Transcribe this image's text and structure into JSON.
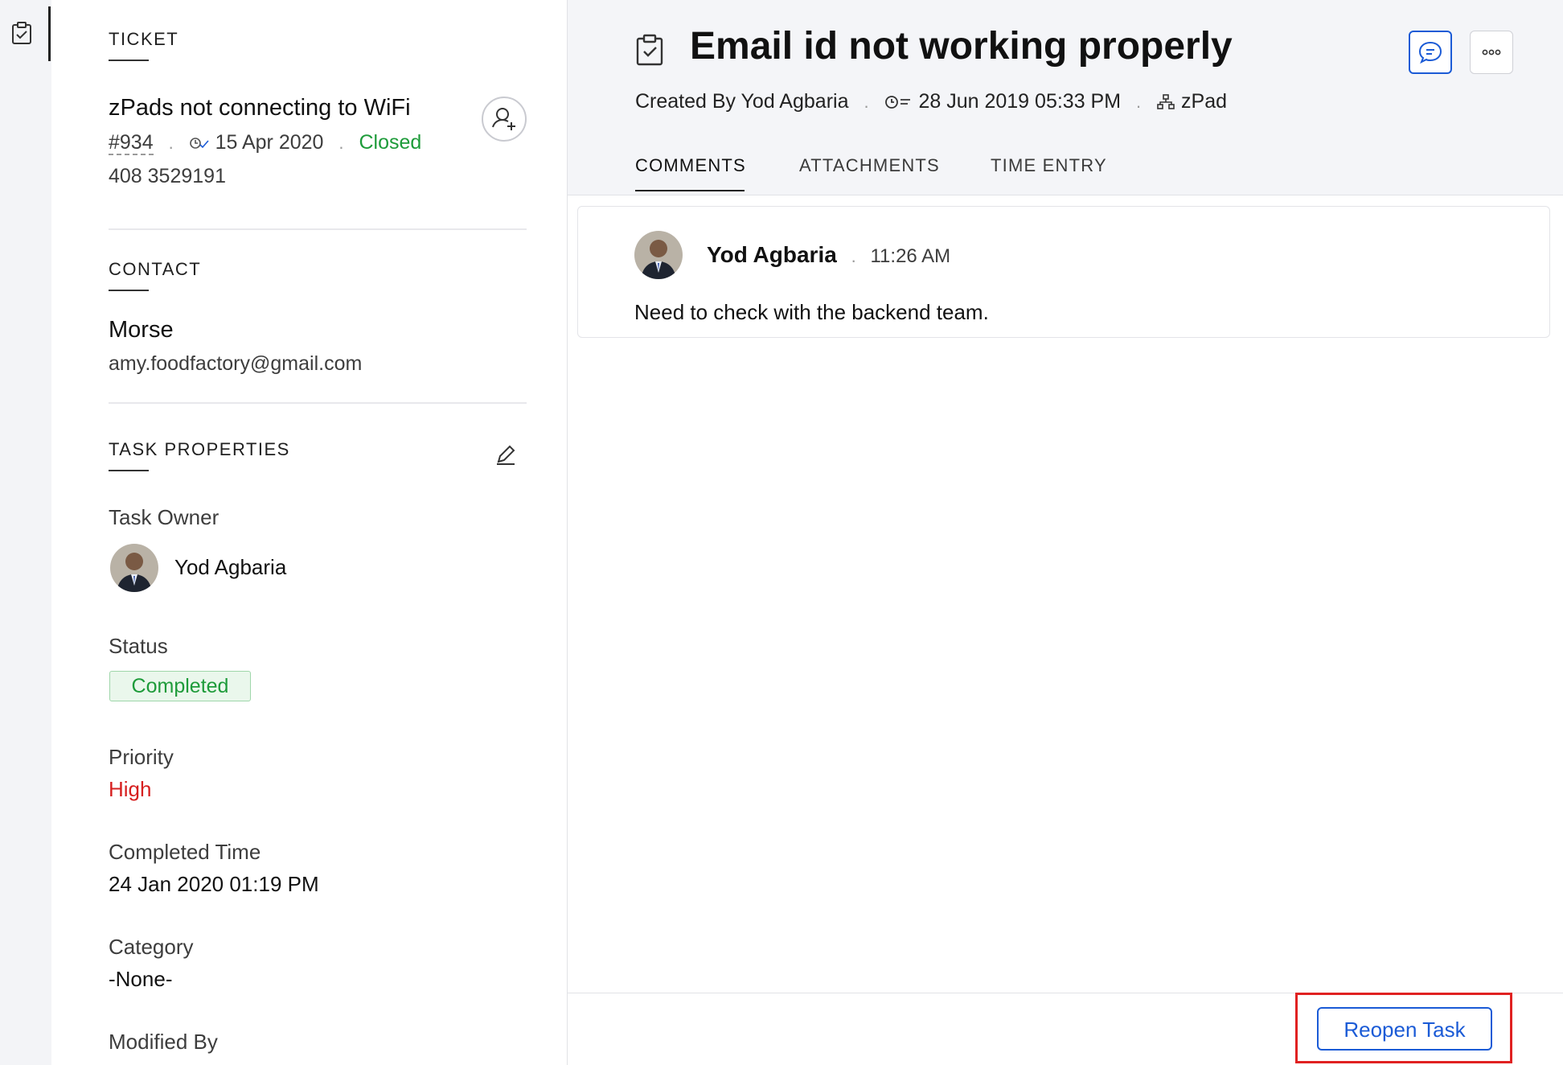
{
  "ticket": {
    "section_title": "TICKET",
    "subject": "zPads not connecting to WiFi",
    "number": "#934",
    "date": "15 Apr 2020",
    "status": "Closed",
    "phone": "408 3529191"
  },
  "contact": {
    "section_title": "CONTACT",
    "name": "Morse",
    "email": "amy.foodfactory@gmail.com"
  },
  "task_properties": {
    "section_title": "TASK PROPERTIES",
    "task_owner_label": "Task Owner",
    "task_owner": "Yod Agbaria",
    "status_label": "Status",
    "status": "Completed",
    "priority_label": "Priority",
    "priority": "High",
    "completed_time_label": "Completed Time",
    "completed_time": "24 Jan 2020 01:19 PM",
    "category_label": "Category",
    "category": "-None-",
    "modified_by_label": "Modified By"
  },
  "task": {
    "title": "Email id not working properly",
    "created_by": "Created By Yod Agbaria",
    "created_time": "28 Jun 2019 05:33 PM",
    "department": "zPad"
  },
  "tabs": [
    {
      "label": "COMMENTS",
      "active": true
    },
    {
      "label": "ATTACHMENTS",
      "active": false
    },
    {
      "label": "TIME ENTRY",
      "active": false
    }
  ],
  "comment": {
    "author": "Yod Agbaria",
    "time": "11:26 AM",
    "text": "Need to check with the backend team."
  },
  "footer": {
    "reopen_label": "Reopen Task"
  },
  "colors": {
    "accent": "#1b5bd6",
    "closed_green": "#1e9b3a",
    "completed_bg": "#eaf7ec",
    "priority_red": "#d61f1f",
    "highlight_red": "#e02121"
  }
}
